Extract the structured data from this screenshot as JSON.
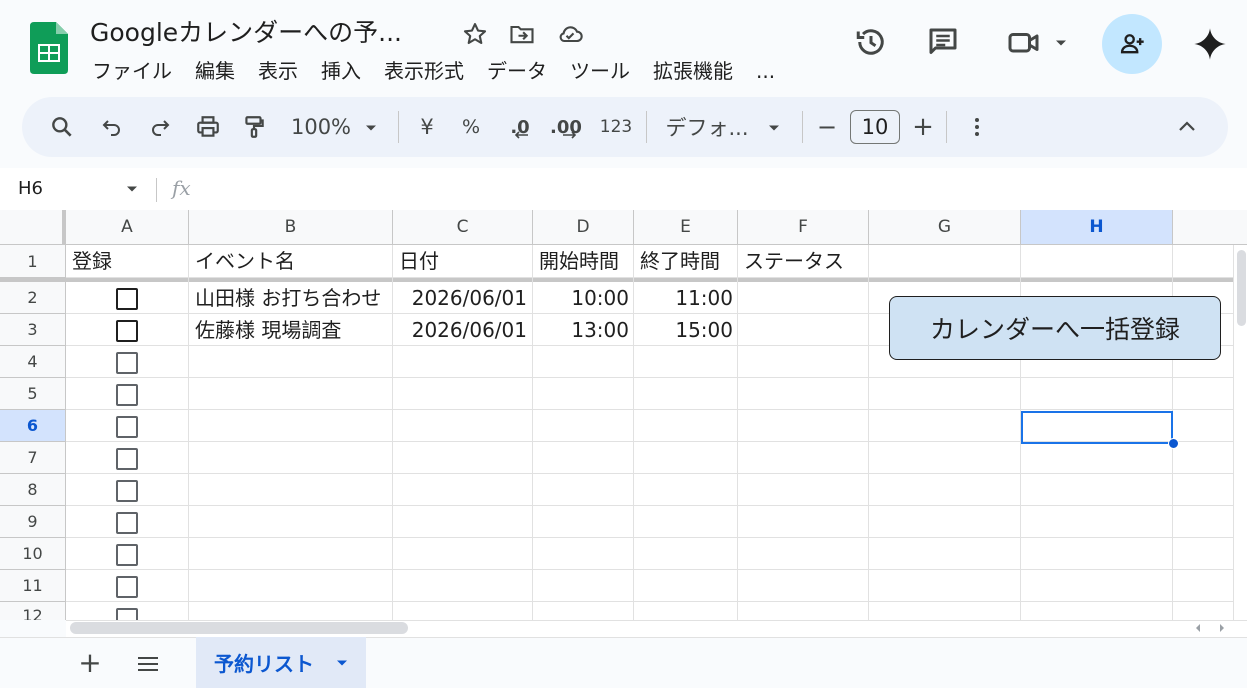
{
  "app": {
    "doc_title": "Googleカレンダーへの予...",
    "menus": [
      "ファイル",
      "編集",
      "表示",
      "挿入",
      "表示形式",
      "データ",
      "ツール",
      "拡張機能",
      "..."
    ]
  },
  "toolbar": {
    "zoom": "100%",
    "currency": "¥",
    "percent": "%",
    "dec_decrease": ".0",
    "dec_increase": ".00",
    "number_format": "123",
    "font": "デフォ...",
    "font_size": "10",
    "minus": "−",
    "plus": "+"
  },
  "formula_bar": {
    "name_box": "H6",
    "fx": "fx"
  },
  "grid": {
    "columns": [
      "A",
      "B",
      "C",
      "D",
      "E",
      "F",
      "G",
      "H"
    ],
    "rows": [
      "1",
      "2",
      "3",
      "4",
      "5",
      "6",
      "7",
      "8",
      "9",
      "10",
      "11",
      "12"
    ],
    "header_row": [
      "登録",
      "イベント名",
      "日付",
      "開始時間",
      "終了時間",
      "ステータス"
    ],
    "data_rows": [
      {
        "event": "山田様 お打ち合わせ",
        "date": "2026/06/01",
        "start": "10:00",
        "end": "11:00"
      },
      {
        "event": "佐藤様 現場調査",
        "date": "2026/06/01",
        "start": "13:00",
        "end": "15:00"
      }
    ],
    "selected_cell": "H6",
    "button_label": "カレンダーへ一括登録"
  },
  "sheet_tabs": {
    "add": "+",
    "active_tab": "予約リスト"
  },
  "colors": {
    "accent": "#0b57d0",
    "share_bg": "#c2e7ff",
    "sheets_green": "#0f9d58",
    "button_fill": "#cfe2f3"
  }
}
